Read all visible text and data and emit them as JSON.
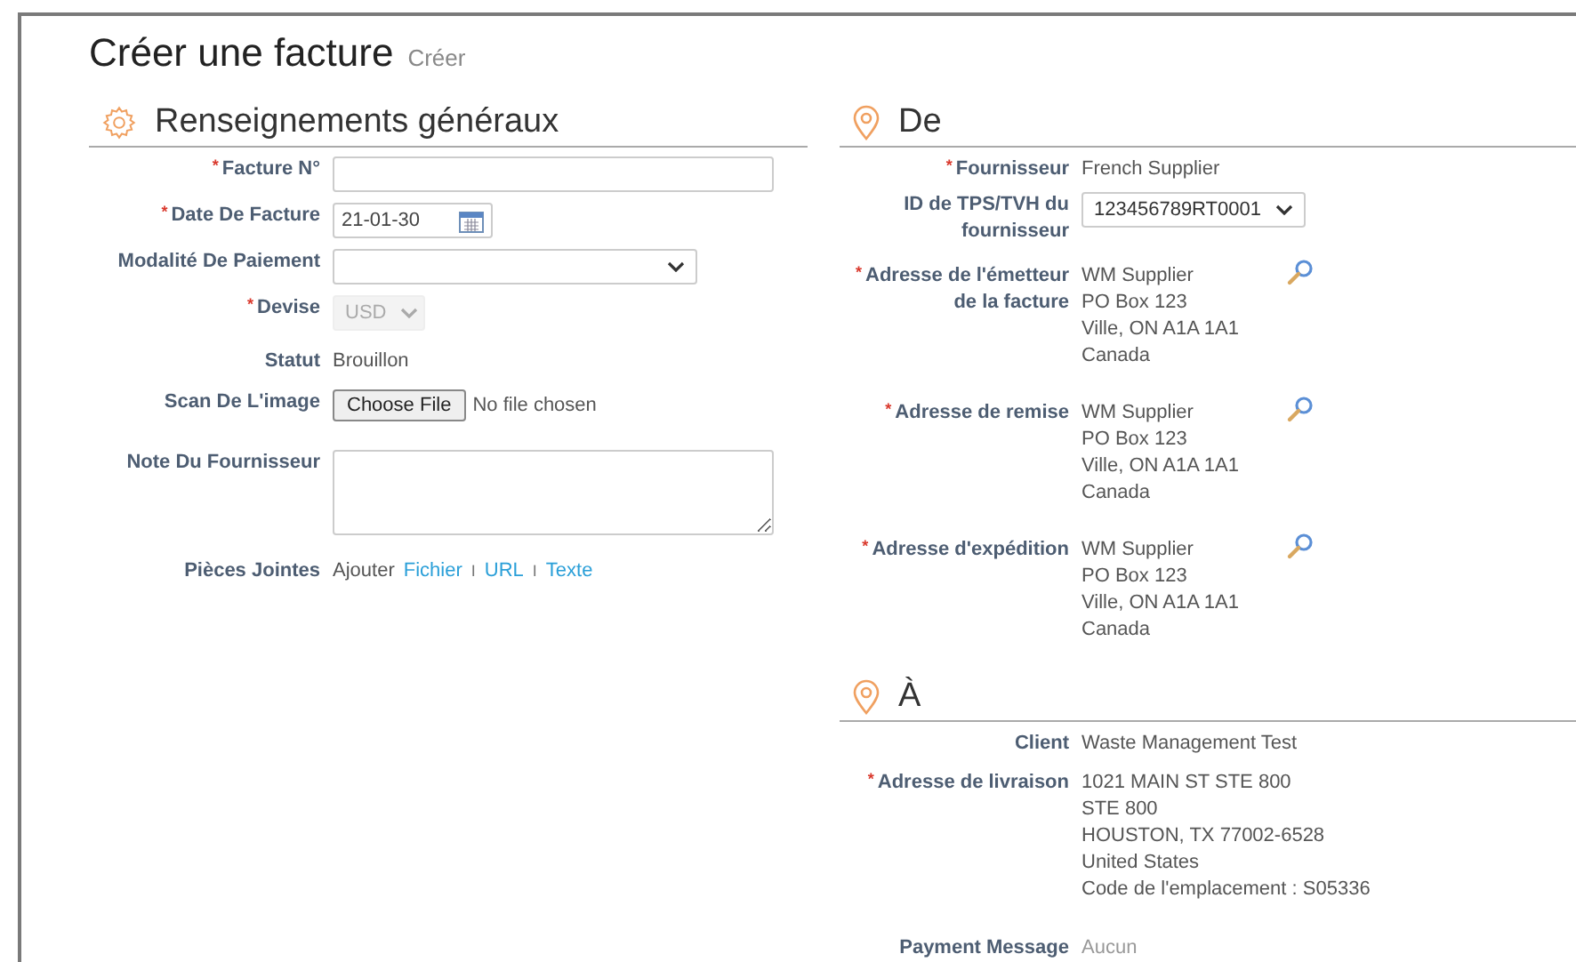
{
  "title": "Créer une facture",
  "subtitle": "Créer",
  "general": {
    "title": "Renseignements généraux",
    "fields": [
      {
        "kind": "input",
        "label": "Facture N°",
        "required_mark": "*"
      },
      {
        "kind": "date",
        "label": "Date De Facture",
        "required_mark": "*",
        "value": "21-01-30"
      },
      {
        "kind": "select",
        "label": "Modalité De Paiement",
        "disabled": false
      },
      {
        "kind": "select",
        "label": "Devise",
        "required_mark": "*",
        "value": "USD",
        "disabled": true
      },
      {
        "kind": "text",
        "label": "Statut",
        "value": "Brouillon"
      },
      {
        "kind": "file",
        "label": "Scan De L'image",
        "button": "Choose File",
        "value": "No file chosen"
      },
      {
        "kind": "textarea",
        "label": "Note Du Fournisseur"
      },
      {
        "kind": "links",
        "label": "Pièces Jointes",
        "prefix": "Ajouter",
        "links": [
          {
            "label": "Fichier"
          },
          {
            "separator": "I",
            "label": "URL"
          },
          {
            "separator": "I",
            "label": "Texte"
          }
        ]
      }
    ]
  },
  "from": {
    "title": "De",
    "fields": [
      {
        "kind": "text",
        "label": "Fournisseur",
        "required_mark": "*",
        "value": "French Supplier"
      },
      {
        "kind": "select",
        "label": "ID de TPS/TVH du fournisseur",
        "value": "123456789RT0001",
        "disabled": false
      },
      {
        "kind": "address",
        "label": "Adresse de l'émetteur de la facture",
        "required_mark": "*",
        "lines": [
          "WM Supplier",
          "PO Box 123",
          "Ville, ON A1A 1A1",
          "Canada"
        ]
      },
      {
        "kind": "address",
        "label": "Adresse de remise",
        "required_mark": "*",
        "lines": [
          "WM Supplier",
          "PO Box 123",
          "Ville, ON A1A 1A1",
          "Canada"
        ]
      },
      {
        "kind": "address",
        "label": "Adresse d'expédition",
        "required_mark": "*",
        "lines": [
          "WM Supplier",
          "PO Box 123",
          "Ville, ON A1A 1A1",
          "Canada"
        ]
      }
    ]
  },
  "to": {
    "title": "À",
    "fields": [
      {
        "kind": "text",
        "label": "Client",
        "value": "Waste Management Test"
      },
      {
        "kind": "lines",
        "label": "Adresse de livraison",
        "required_mark": "*",
        "lines": [
          "1021 MAIN ST STE 800",
          "STE 800",
          "HOUSTON, TX 77002-6528",
          "United States",
          "Code de l'emplacement : S05336"
        ]
      },
      {
        "kind": "muted",
        "label": "Payment Message",
        "value": "Aucun"
      }
    ]
  }
}
